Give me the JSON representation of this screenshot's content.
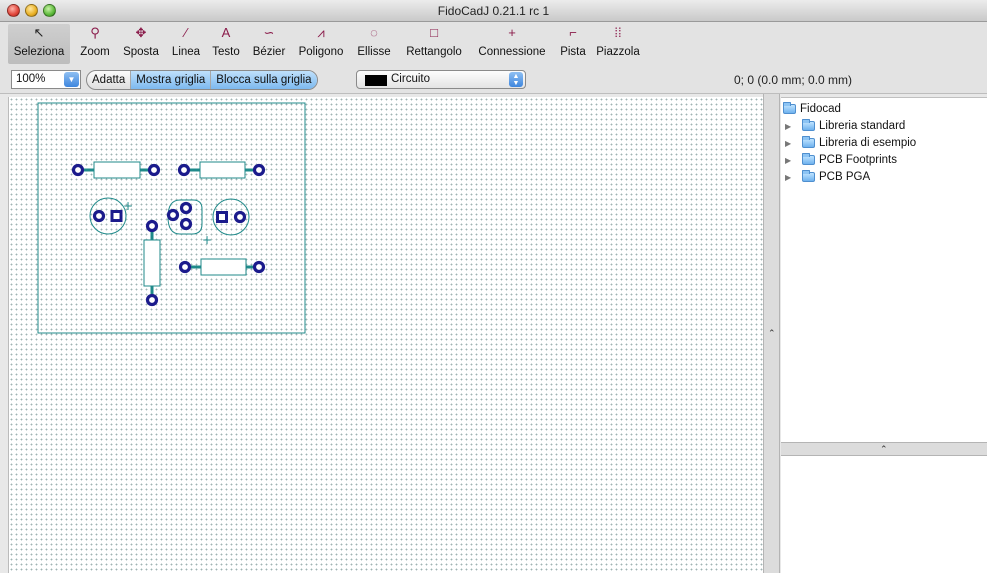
{
  "window": {
    "title": "FidoCadJ 0.21.1 rc 1"
  },
  "toolbar": {
    "tools": [
      {
        "id": "selection",
        "icon": "arrow-icon",
        "glyph": "↖",
        "label": "Seleziona"
      },
      {
        "id": "zoom",
        "icon": "magnifier-icon",
        "glyph": "⚲",
        "label": "Zoom"
      },
      {
        "id": "move",
        "icon": "move-icon",
        "glyph": "✥",
        "label": "Sposta"
      },
      {
        "id": "line",
        "icon": "line-icon",
        "glyph": "⁄",
        "label": "Linea"
      },
      {
        "id": "text",
        "icon": "text-icon",
        "glyph": "A",
        "label": "Testo"
      },
      {
        "id": "bezier",
        "icon": "bezier-icon",
        "glyph": "∽",
        "label": "Bézier"
      },
      {
        "id": "polygon",
        "icon": "polygon-icon",
        "glyph": "⩘",
        "label": "Poligono"
      },
      {
        "id": "ellipse",
        "icon": "ellipse-icon",
        "glyph": "◌",
        "label": "Ellisse"
      },
      {
        "id": "rectangle",
        "icon": "rectangle-icon",
        "glyph": "□",
        "label": "Rettangolo"
      },
      {
        "id": "connection",
        "icon": "connection-icon",
        "glyph": "+",
        "label": "Connessione"
      },
      {
        "id": "track",
        "icon": "track-icon",
        "glyph": "⌐",
        "label": "Pista"
      },
      {
        "id": "pad",
        "icon": "pad-icon",
        "glyph": "⁞⁞",
        "label": "Piazzola"
      }
    ]
  },
  "options": {
    "zoom_value": "100%",
    "fit_label": "Adatta",
    "show_grid_label": "Mostra griglia",
    "snap_grid_label": "Blocca sulla griglia",
    "layer_name": "Circuito",
    "layer_color": "#000000",
    "coordinates": "0; 0 (0.0 mm; 0.0 mm)"
  },
  "library": {
    "root": "Fidocad",
    "items": [
      "Libreria standard",
      "Libreria di esempio",
      "PCB Footprints",
      "PCB PGA"
    ]
  },
  "colors": {
    "board_outline": "#1f8a8a",
    "pad_color": "#1b1b8c",
    "track_color": "#1f8a8a",
    "selected_tool_icon": "#222222",
    "tool_icon": "#8a1b4a"
  }
}
